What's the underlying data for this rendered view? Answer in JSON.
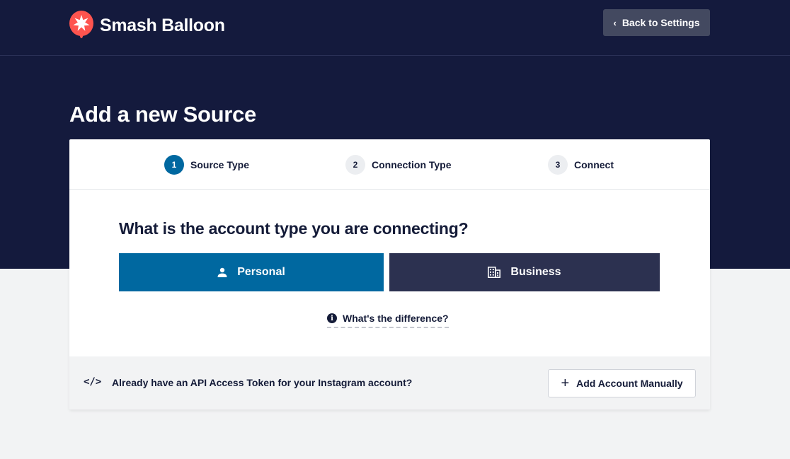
{
  "brand": {
    "name": "Smash Balloon",
    "logo_icon": "balloon-star-icon",
    "logo_color": "#fe544f"
  },
  "header": {
    "back_button": "Back to Settings",
    "back_icon": "chevron-left-icon"
  },
  "page": {
    "title": "Add a new Source"
  },
  "steps": [
    {
      "number": "1",
      "label": "Source Type",
      "active": true
    },
    {
      "number": "2",
      "label": "Connection Type",
      "active": false
    },
    {
      "number": "3",
      "label": "Connect",
      "active": false
    }
  ],
  "question": "What is the account type you are connecting?",
  "account_types": {
    "personal": {
      "label": "Personal",
      "icon": "person-icon"
    },
    "business": {
      "label": "Business",
      "icon": "building-icon"
    }
  },
  "difference_link": {
    "label": "What's the difference?",
    "icon": "info-icon"
  },
  "footer": {
    "icon": "code-icon",
    "icon_text": "</>",
    "token_text": "Already have an API Access Token for your Instagram account?",
    "add_manual_button": "Add Account Manually",
    "add_manual_icon": "plus-icon"
  },
  "colors": {
    "header_bg": "#141a3d",
    "primary": "#0068a0",
    "business_bg": "#2c3150",
    "back_button_bg": "#434960"
  }
}
